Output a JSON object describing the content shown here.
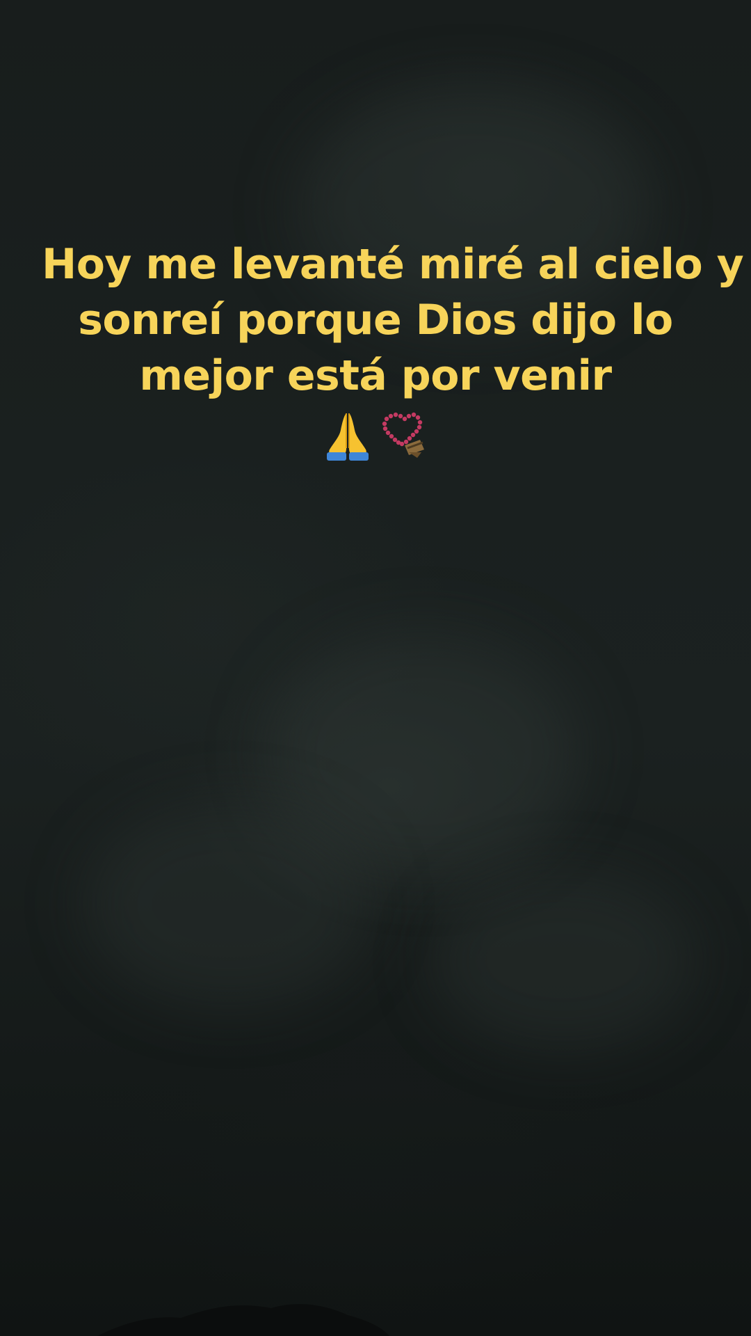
{
  "background": {
    "description_color": "#181d1c"
  },
  "caption": {
    "lines": [
      "Hoy me levanté miré al cielo y",
      "sonreí porque Dios dijo lo",
      "mejor está por venir"
    ],
    "color": "#f7d45a"
  },
  "emojis": [
    {
      "icon": "praying-hands-icon"
    },
    {
      "icon": "prayer-beads-icon"
    }
  ]
}
